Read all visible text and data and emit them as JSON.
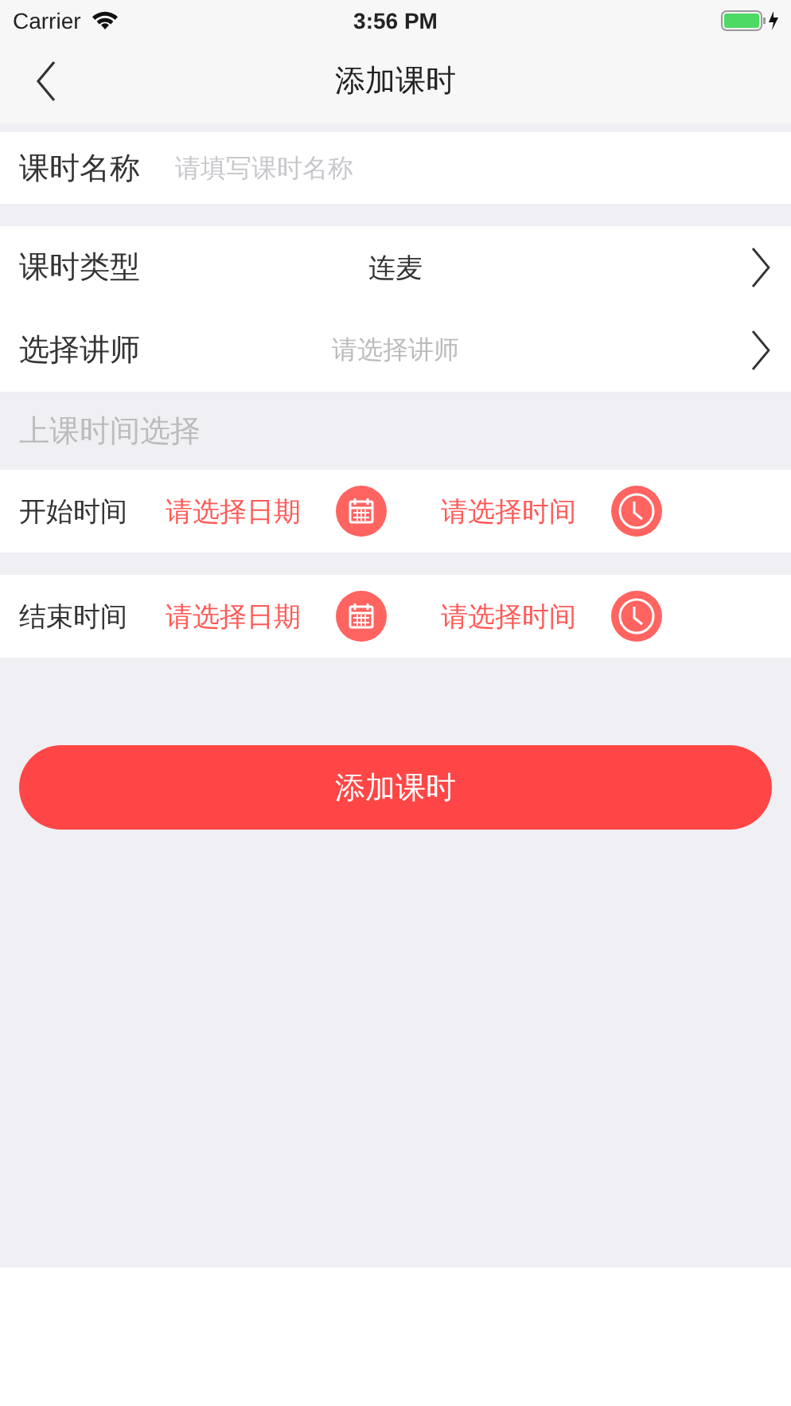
{
  "status_bar": {
    "carrier": "Carrier",
    "time": "3:56 PM"
  },
  "nav": {
    "title": "添加课时"
  },
  "name_field": {
    "label": "课时名称",
    "placeholder": "请填写课时名称"
  },
  "pickers": [
    {
      "label": "课时类型",
      "value": "连麦"
    },
    {
      "label": "选择讲师",
      "placeholder": "请选择讲师"
    }
  ],
  "schedule": {
    "heading": "上课时间选择",
    "rows": [
      {
        "label": "开始时间",
        "date": "请选择日期",
        "time": "请选择时间"
      },
      {
        "label": "结束时间",
        "date": "请选择日期",
        "time": "请选择时间"
      }
    ]
  },
  "submit_button": "添加课时"
}
